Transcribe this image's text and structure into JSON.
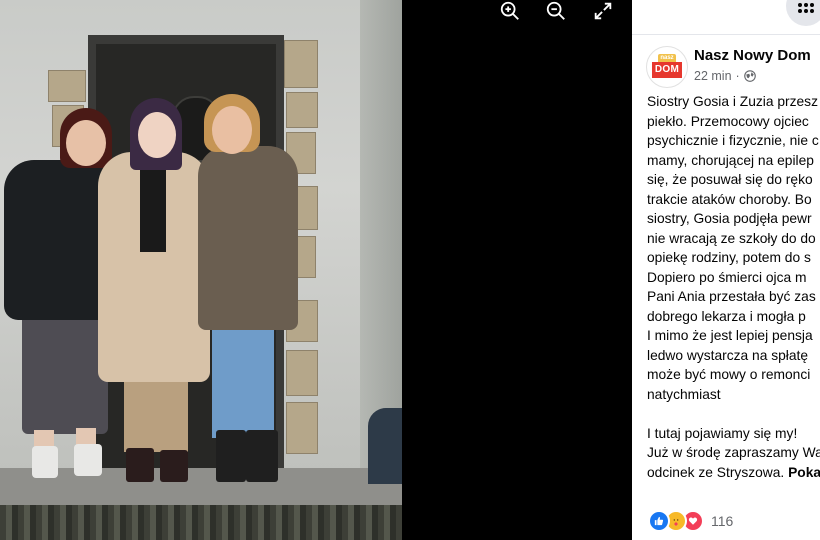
{
  "viewer": {
    "controls": [
      {
        "name": "zoom-in-icon"
      },
      {
        "name": "zoom-out-icon"
      },
      {
        "name": "fullscreen-icon"
      }
    ]
  },
  "header": {
    "menu_icon": "grid-menu-icon"
  },
  "post": {
    "page_name": "Nasz Nowy Dom",
    "avatar_top": "nasz",
    "avatar_bottom": "DOM",
    "time": "22 min",
    "separator": "·",
    "audience_icon": "globe-icon",
    "lines": [
      "Siostry Gosia i Zuzia przesz",
      "piekło. Przemocowy ojciec",
      "psychicznie i fizycznie, nie c",
      "mamy, chorującej na epilep",
      "się, że posuwał się do ręko",
      "trakcie ataków choroby. Bo",
      "siostry, Gosia podjęła pewr",
      "nie wracają ze szkoły do do",
      "opiekę rodziny, potem do s",
      "Dopiero po śmierci ojca m",
      "Pani Ania przestała być zas",
      "dobrego lekarza i mogła p",
      "I mimo że jest lepiej pensja",
      "ledwo wystarcza na spłatę",
      "może być mowy o remonci",
      "natychmiast"
    ],
    "lines2_a": "I tutaj pojawiamy się my!",
    "lines2_b": "Już w środę zapraszamy Wa",
    "lines2_c_pre": "odcinek ze Stryszowa. ",
    "lines2_c_bold": "Poka",
    "reaction_count": "116"
  }
}
